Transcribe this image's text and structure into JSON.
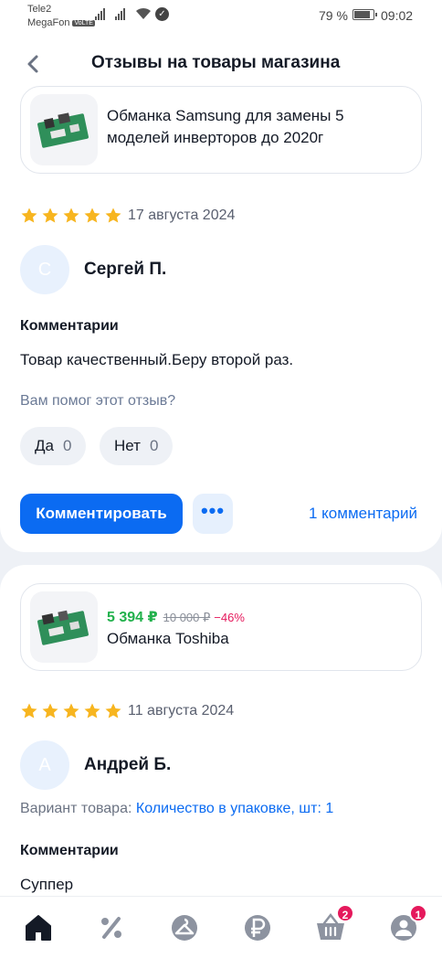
{
  "status_bar": {
    "operator1": "Tele2",
    "operator2": "MegaFon",
    "volte": "VoLTE",
    "battery": "79 %",
    "battery_level": 0.79,
    "time": "09:02"
  },
  "header": {
    "title": "Отзывы на товары магазина"
  },
  "reviews": [
    {
      "product_name": "Обманка Samsung для замены 5 моделей инверторов до 2020г",
      "rating": 5,
      "date": "17 августа 2024",
      "avatar_letter": "С",
      "author": "Сергей П.",
      "comments_label": "Комментарии",
      "comment": "Товар качественный.Беру второй раз.",
      "helpful_question": "Вам помог этот отзыв?",
      "yes_label": "Да",
      "yes_count": "0",
      "no_label": "Нет",
      "no_count": "0",
      "comment_button": "Комментировать",
      "more_button": "•••",
      "comments_link": "1 комментарий"
    },
    {
      "product_name": "Обманка Toshiba",
      "price_new": "5 394 ₽",
      "price_old": "10 000 ₽",
      "discount": "−46%",
      "rating": 5,
      "date": "11 августа 2024",
      "avatar_letter": "А",
      "author": "Андрей Б.",
      "variant_label": "Вариант товара:",
      "variant_value": "Количество в упаковке, шт: 1",
      "comments_label": "Комментарии",
      "comment": "Суппер"
    }
  ],
  "bottom_nav": {
    "items": [
      {
        "icon": "home-icon"
      },
      {
        "icon": "percent-icon"
      },
      {
        "icon": "catalog-icon"
      },
      {
        "icon": "ruble-icon"
      },
      {
        "icon": "cart-icon",
        "badge": "2"
      },
      {
        "icon": "profile-icon",
        "badge": "1"
      }
    ]
  },
  "colors": {
    "accent": "#0b6bf2",
    "star": "#f7b51f",
    "price_green": "#22b14c",
    "discount_red": "#e5195c"
  }
}
